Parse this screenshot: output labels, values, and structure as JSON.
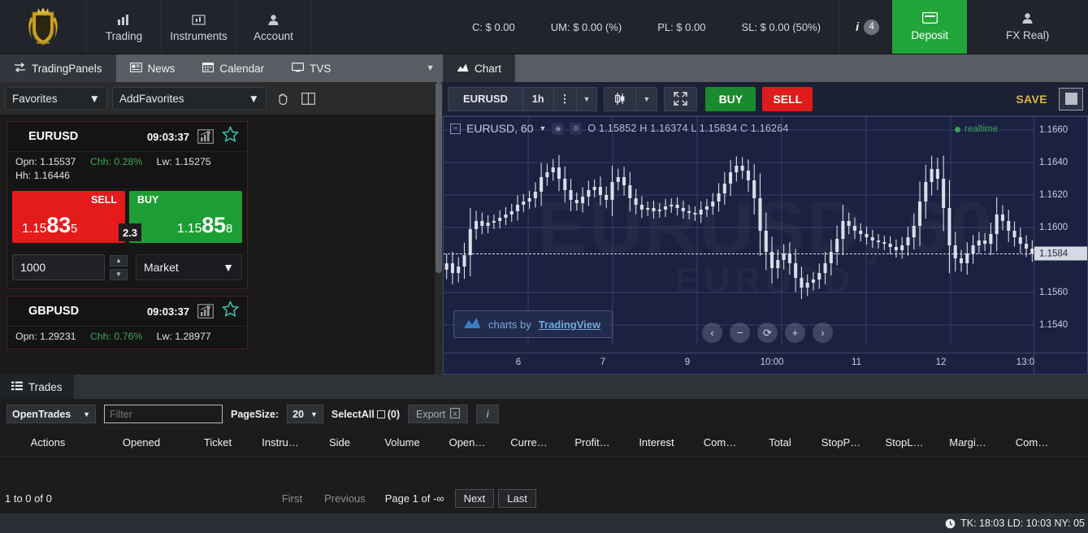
{
  "header": {
    "logo_alt": "broker-crest-logo",
    "nav": [
      {
        "label": "Trading",
        "icon": "bar-chart-icon"
      },
      {
        "label": "Instruments",
        "icon": "instruments-icon"
      },
      {
        "label": "Account",
        "icon": "user-icon"
      }
    ],
    "stats": [
      {
        "label": "C: $ 0.00"
      },
      {
        "label": "UM: $ 0.00 (%)"
      },
      {
        "label": "PL: $ 0.00"
      },
      {
        "label": "SL: $ 0.00 (50%)"
      }
    ],
    "info_icon": "i",
    "notification_count": "4",
    "deposit_label": "Deposit",
    "deposit_icon": "card-icon",
    "account_label": "FX Real)",
    "account_icon": "user-icon",
    "deposit_color": "#22a63a"
  },
  "tabs_left": [
    {
      "label": "TradingPanels",
      "icon": "exchange-icon",
      "active": true
    },
    {
      "label": "News",
      "icon": "news-icon",
      "active": false
    },
    {
      "label": "Calendar",
      "icon": "calendar-icon",
      "active": false
    },
    {
      "label": "TVS",
      "icon": "monitor-icon",
      "active": false
    }
  ],
  "tabs_right": [
    {
      "label": "Chart",
      "icon": "chart-icon",
      "active": true
    }
  ],
  "left_panel": {
    "favorites_select": "Favorites",
    "add_favorites_select": "AddFavorites",
    "hand_icon": "hand-icon",
    "layout_icon": "columns-icon",
    "instruments": [
      {
        "symbol": "EURUSD",
        "time": "09:03:37",
        "chart_icon": "mini-chart-icon",
        "star_icon": "star-icon",
        "open_label": "Opn: 1.15537",
        "change_label": "Chh: 0.28%",
        "low_label": "Lw: 1.15275",
        "high_label": "Hh: 1.16446",
        "sell_label": "SELL",
        "buy_label": "BUY",
        "sell_price": {
          "lead": "1.15",
          "big": "83",
          "tail": "5"
        },
        "buy_price": {
          "lead": "1.15",
          "big": "85",
          "tail": "8"
        },
        "spread": "2.3",
        "quantity": "1000",
        "order_type": "Market"
      },
      {
        "symbol": "GBPUSD",
        "time": "09:03:37",
        "chart_icon": "mini-chart-icon",
        "star_icon": "star-icon",
        "open_label": "Opn: 1.29231",
        "change_label": "Chh: 0.76%",
        "low_label": "Lw: 1.28977"
      }
    ]
  },
  "chart": {
    "toolbar": {
      "symbol": "EURUSD",
      "interval": "1h",
      "more_icon": "vertical-dots-icon",
      "interval_caret": "chevron-down-icon",
      "style_icon": "candlestick-icon",
      "style_caret": "chevron-down-icon",
      "fullscreen_icon": "expand-icon",
      "buy_label": "BUY",
      "sell_label": "SELL",
      "save_label": "SAVE",
      "color_swatch": "#b8bdc9",
      "buy_color": "#1a8a2e",
      "sell_color": "#e01b1b",
      "save_color": "#d9b74a"
    },
    "legend": {
      "collapse_icon": "minus-box-icon",
      "title": "EURUSD, 60",
      "title_caret": "chevron-down-icon",
      "eye_icon": "eye-icon",
      "settings_icon": "gear-icon",
      "ohlc": "O 1.15852 H 1.16374 L 1.15834 C 1.16264"
    },
    "realtime_label": "realtime",
    "realtime_color": "#3c9e5a",
    "watermark_main": "EURUSD, 60",
    "watermark_sub": "EURUSD",
    "tradingview": {
      "prefix": "charts by",
      "link": "TradingView",
      "icon": "tradingview-icon"
    },
    "nav_buttons": [
      {
        "icon": "chevron-left-icon",
        "label": "‹"
      },
      {
        "icon": "minus-icon",
        "label": "−"
      },
      {
        "icon": "reset-icon",
        "label": "⟳"
      },
      {
        "icon": "plus-icon",
        "label": "+"
      },
      {
        "icon": "chevron-right-icon",
        "label": "›"
      }
    ]
  },
  "chart_data": {
    "type": "line",
    "title": "EURUSD, 60",
    "xlabel": "",
    "ylabel": "",
    "grid": true,
    "legend_position": "top-left",
    "ohlc_header": {
      "open": 1.15852,
      "high": 1.16374,
      "low": 1.15834,
      "close": 1.16264
    },
    "ylim": [
      1.1528,
      1.1668
    ],
    "yticks": [
      "1.1660",
      "1.1640",
      "1.1620",
      "1.1600",
      "1.1560",
      "1.1540"
    ],
    "ytick_values": [
      1.166,
      1.164,
      1.162,
      1.16,
      1.156,
      1.154
    ],
    "last_price": "1.1584",
    "last_price_value": 1.1584,
    "xticks": [
      "6",
      "7",
      "9",
      "10:00",
      "11",
      "12",
      "13:0"
    ],
    "candle_color_up": "#d9dde8",
    "candle_color_down": "#d9dde8",
    "background": "#1b2140",
    "closes": [
      1.1578,
      1.1572,
      1.1576,
      1.1583,
      1.1599,
      1.1604,
      1.1601,
      1.1603,
      1.1604,
      1.1606,
      1.1608,
      1.161,
      1.1614,
      1.1616,
      1.1618,
      1.1622,
      1.1631,
      1.1634,
      1.1637,
      1.163,
      1.1623,
      1.1617,
      1.1615,
      1.1619,
      1.1623,
      1.1625,
      1.162,
      1.1617,
      1.1628,
      1.1631,
      1.1626,
      1.1618,
      1.1614,
      1.1611,
      1.1612,
      1.161,
      1.1611,
      1.1613,
      1.1614,
      1.1612,
      1.161,
      1.1609,
      1.1608,
      1.1611,
      1.1613,
      1.1616,
      1.1621,
      1.1627,
      1.1634,
      1.1638,
      1.1635,
      1.1629,
      1.1618,
      1.1598,
      1.1585,
      1.1575,
      1.158,
      1.1584,
      1.1578,
      1.1569,
      1.1563,
      1.1566,
      1.1568,
      1.1572,
      1.1578,
      1.1585,
      1.1593,
      1.1604,
      1.1601,
      1.1598,
      1.1596,
      1.1594,
      1.1592,
      1.1591,
      1.159,
      1.1588,
      1.1586,
      1.1589,
      1.1594,
      1.1601,
      1.1616,
      1.1628,
      1.1636,
      1.163,
      1.1612,
      1.1589,
      1.1581,
      1.1578,
      1.1584,
      1.1589,
      1.1592,
      1.159,
      1.1596,
      1.1608,
      1.1604,
      1.1598,
      1.1594,
      1.159,
      1.1587,
      1.1584
    ]
  },
  "trades": {
    "tab_label": "Trades",
    "tab_icon": "list-icon",
    "toolbar": {
      "view_select": "OpenTrades",
      "filter_placeholder": "Filter",
      "filter_value": "",
      "pagesize_label": "PageSize:",
      "pagesize_value": "20",
      "selectall_label": "SelectAll",
      "selectall_count": "(0)",
      "export_label": "Export",
      "export_icon": "export-icon",
      "info_label": "i"
    },
    "columns": [
      "Actions",
      "Opened",
      "Ticket",
      "Instru…",
      "Side",
      "Volume",
      "Open…",
      "Curre…",
      "Profit…",
      "Interest",
      "Com…",
      "Total",
      "StopP…",
      "StopL…",
      "Margi…",
      "Com…"
    ],
    "rows": [],
    "pager": {
      "count_label": "1 to 0 of 0",
      "first": "First",
      "previous": "Previous",
      "page_label": "Page 1 of -∞",
      "next": "Next",
      "last": "Last"
    }
  },
  "statusbar": {
    "clock_icon": "clock-icon",
    "text": "TK: 18:03 LD: 10:03 NY: 05"
  }
}
